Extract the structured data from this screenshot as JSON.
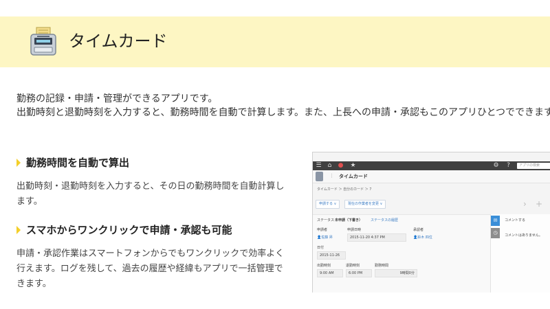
{
  "header": {
    "title": "タイムカード",
    "icon": "time-card-machine-icon"
  },
  "intro": {
    "line1": "勤務の記録・申請・管理ができるアプリです。",
    "line2": "出勤時刻と退勤時刻を入力すると、勤務時間を自動で計算します。また、上長への申請・承認もこのアプリひとつでできます。"
  },
  "features": [
    {
      "heading": "勤務時間を自動で算出",
      "body": "出勤時刻・退勤時刻を入力すると、その日の勤務時間を自動計算します。"
    },
    {
      "heading": "スマホからワンクリックで申請・承認も可能",
      "body": "申請・承認作業はスマートフォンからでもワンクリックで効率よく行えます。ログを残して、過去の履歴や経緯もアプリで一括管理できます。"
    }
  ],
  "screenshot": {
    "search_placeholder": "アプリの検索",
    "app_title": "タイムカード",
    "breadcrumb": "タイムカード ＞ 自分のカード ＞ 7",
    "apply_button": "申請する",
    "assignee_button": "現在の作業者を変更",
    "status_label": "ステータス",
    "status_value": "未申請（下書き）",
    "status_history": "ステータスの履歴",
    "applicant_label": "申請者",
    "applicant_value": "佐藤 昇",
    "date_time_label": "申請日時",
    "date_time_value": "2015-11-20 4:37 PM",
    "approver_label": "承認者",
    "approver_value": "鈴木 四位",
    "date_label": "日付",
    "date_value": "2015-11-26",
    "clock_in_label": "出勤時刻",
    "clock_in_value": "9:00 AM",
    "clock_out_label": "退勤時刻",
    "clock_out_value": "6:00 PM",
    "work_time_label": "勤務時間",
    "work_time_value": "9時間0分",
    "comment_prompt": "コメントする",
    "no_comments": "コメントはありません。"
  }
}
